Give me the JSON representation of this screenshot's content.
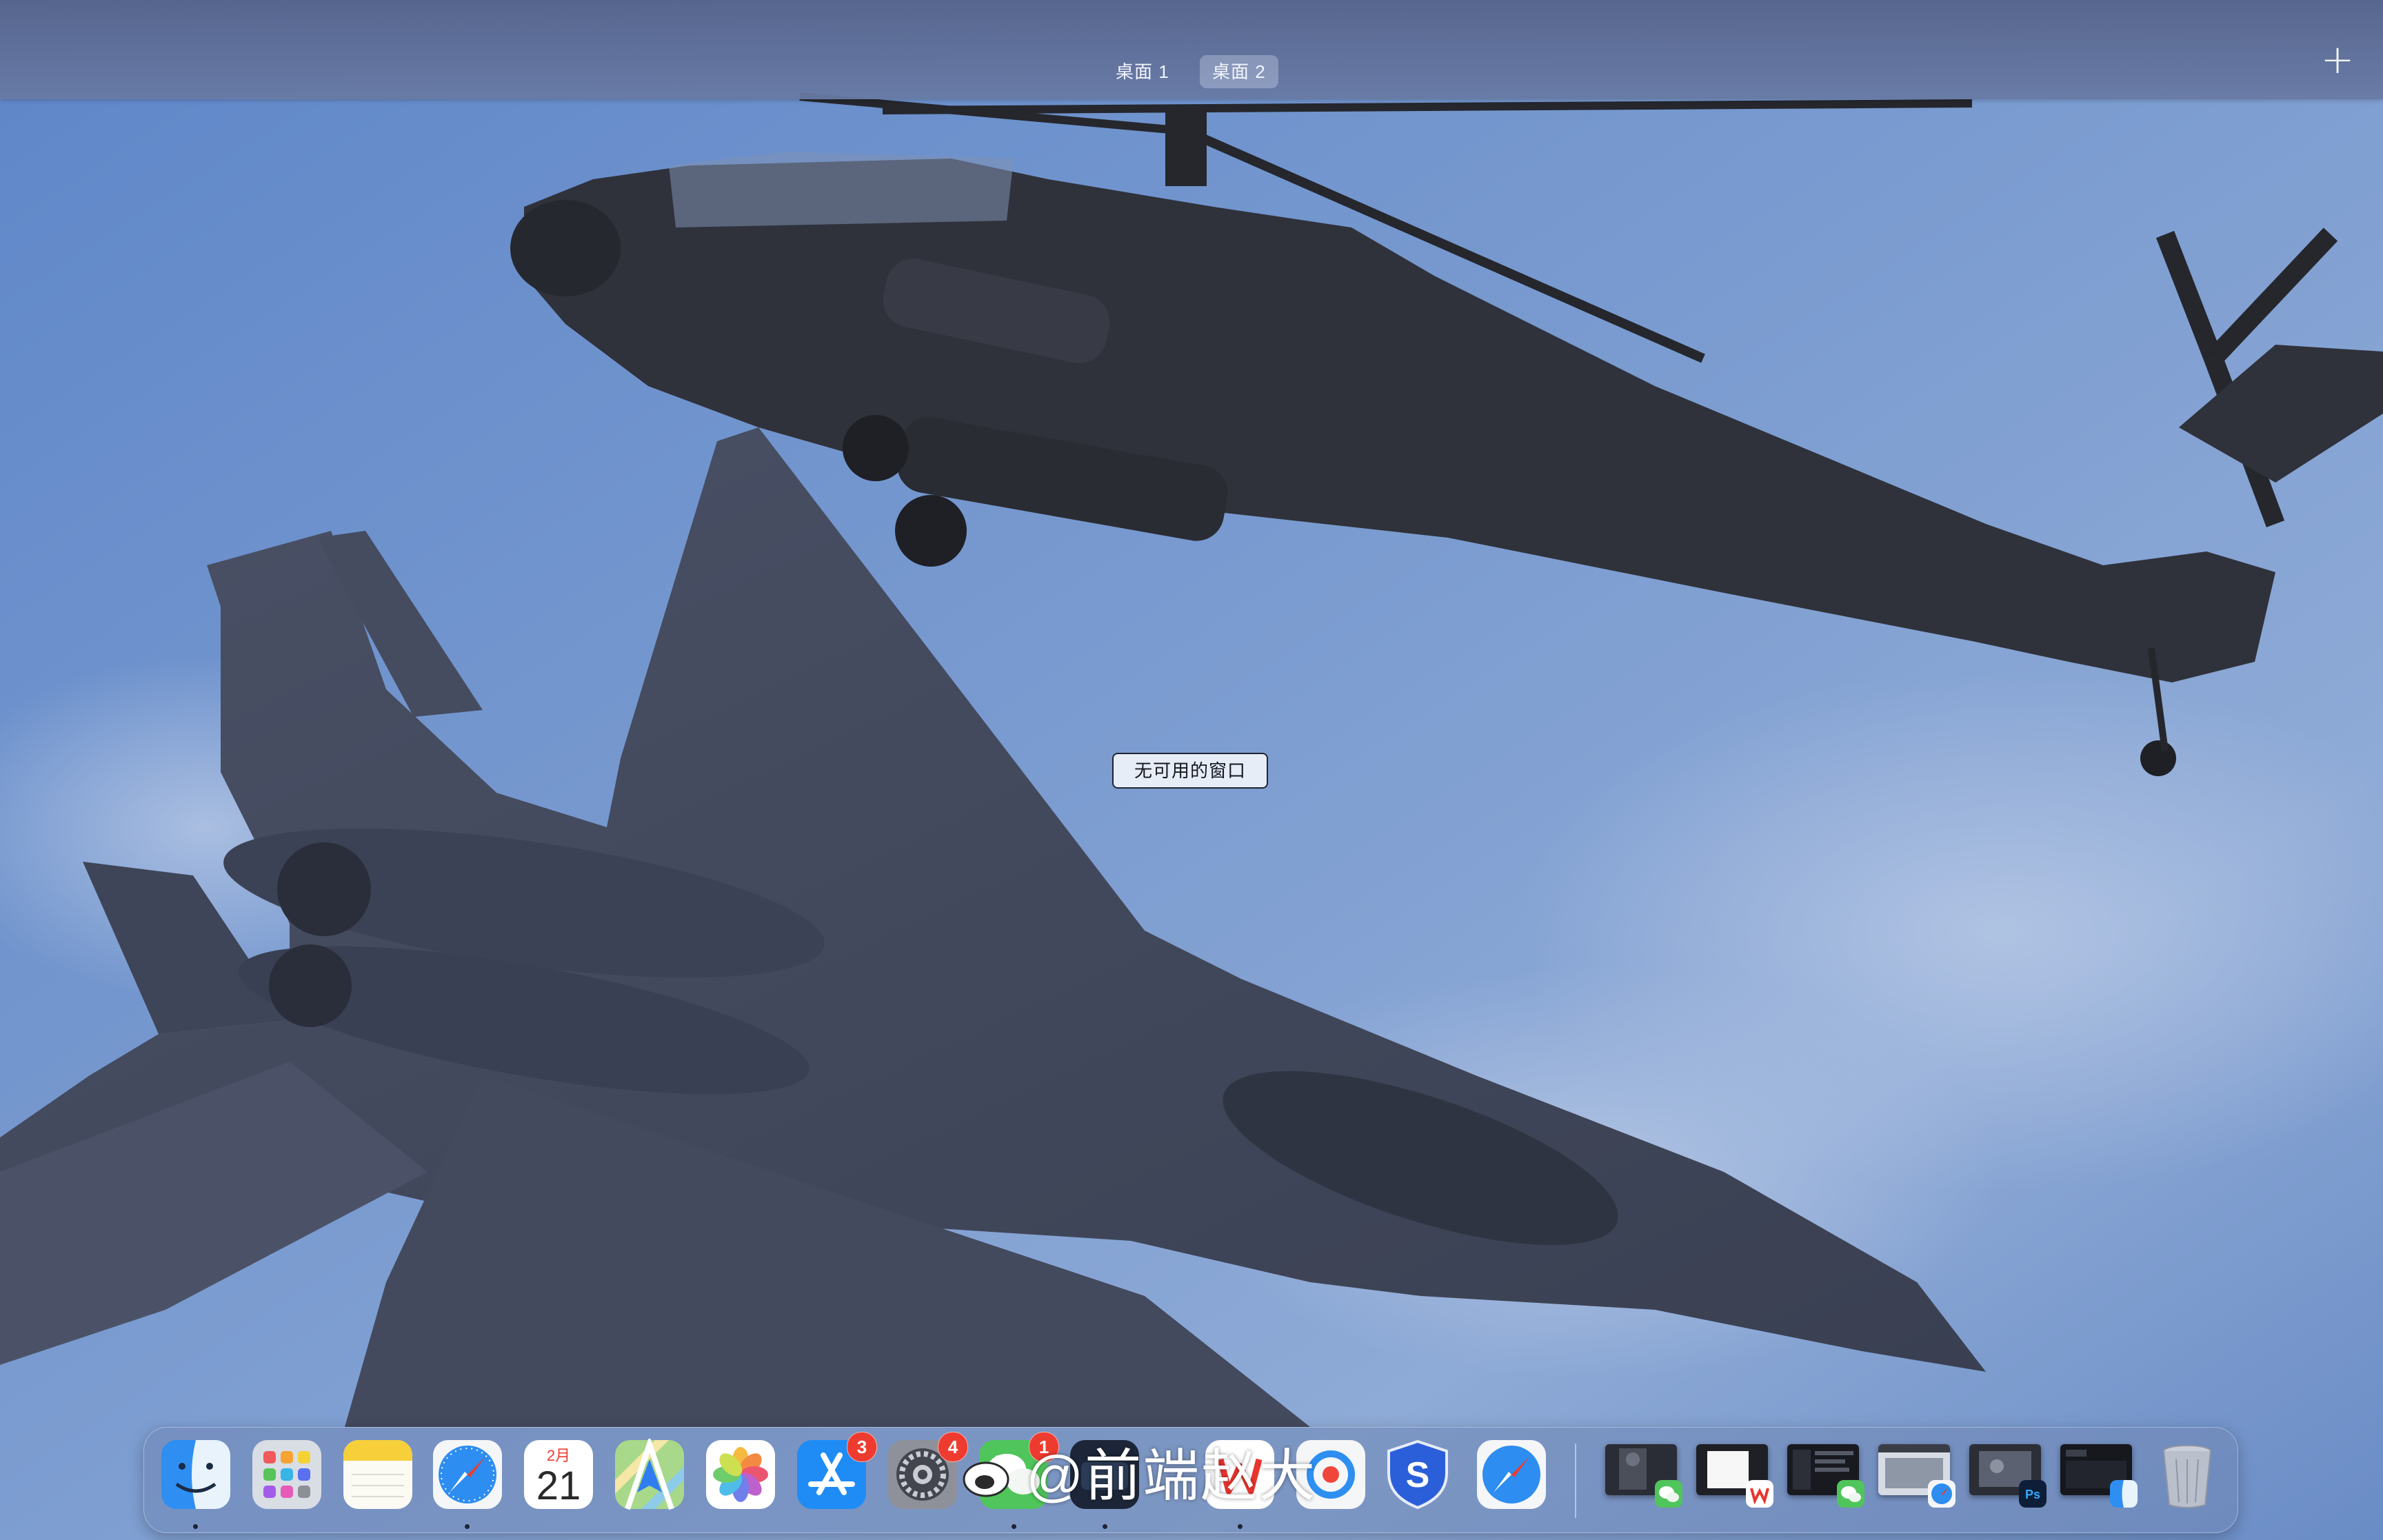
{
  "spaces_bar": {
    "tabs": [
      {
        "label": "桌面 1",
        "active": false
      },
      {
        "label": "桌面 2",
        "active": true
      }
    ],
    "add_icon": "plus-icon"
  },
  "desktop": {
    "wallpaper": "helicopter-and-fighter-jet-photo",
    "empty_label": "无可用的窗口"
  },
  "dock": {
    "apps": [
      {
        "name": "Finder",
        "icon": "finder-icon",
        "running": true
      },
      {
        "name": "Launchpad",
        "icon": "launchpad-icon",
        "running": false
      },
      {
        "name": "Notes",
        "icon": "notes-icon",
        "running": false
      },
      {
        "name": "Safari",
        "icon": "safari-icon",
        "running": true
      },
      {
        "name": "Calendar",
        "icon": "calendar-icon",
        "month": "2月",
        "day": "21",
        "running": false
      },
      {
        "name": "Maps",
        "icon": "maps-icon",
        "running": false
      },
      {
        "name": "Photos",
        "icon": "photos-icon",
        "running": false
      },
      {
        "name": "App Store",
        "icon": "app-store-icon",
        "badge": "3",
        "running": false
      },
      {
        "name": "System Settings",
        "icon": "settings-icon",
        "badge": "4",
        "running": false
      },
      {
        "name": "WeChat",
        "icon": "wechat-icon",
        "badge": "1",
        "running": true
      },
      {
        "name": "App",
        "icon": "dark-app-icon",
        "running": true
      },
      {
        "name": "WPS",
        "icon": "wps-icon",
        "running": true
      },
      {
        "name": "Browser",
        "icon": "browser-icon",
        "running": false
      },
      {
        "name": "S App",
        "icon": "s-shield-icon",
        "running": false
      },
      {
        "name": "Safari",
        "icon": "safari-icon",
        "running": false
      }
    ],
    "minimized_windows": [
      {
        "app_icon": "wechat-icon"
      },
      {
        "app_icon": "wps-icon"
      },
      {
        "app_icon": "wechat-icon"
      },
      {
        "app_icon": "safari-icon"
      },
      {
        "app_icon": "photoshop-icon",
        "app_label": "Ps"
      },
      {
        "app_icon": "finder-icon"
      }
    ],
    "trash_icon": "trash-icon"
  },
  "watermark": {
    "text": "@前端赵大",
    "logo_icon": "weibo-icon"
  },
  "colors": {
    "sky": "#6f8fc4",
    "spaces_bar": "#5f6e98",
    "badge": "#ee3b30"
  }
}
